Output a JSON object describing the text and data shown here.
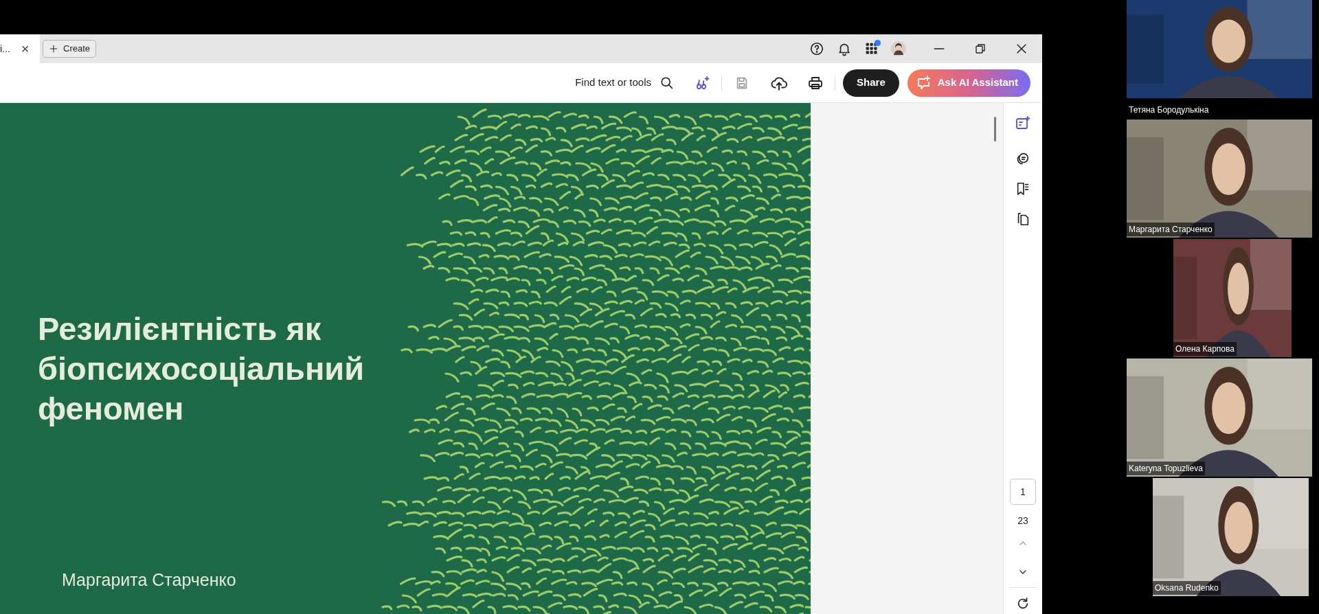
{
  "tabs": [
    {
      "title": "i...",
      "selected": true,
      "close": "×"
    }
  ],
  "create_button": "Create",
  "toolbar": {
    "search_label": "Find text or tools",
    "share_button": "Share",
    "ai_button": "Ask AI Assistant"
  },
  "apps_notification": true,
  "slide": {
    "title_lines": [
      "Резилієнтність як",
      "біопсихосоціальний",
      "феномен"
    ],
    "author": "Маргарита Старченко"
  },
  "page_nav": {
    "current": "1",
    "total": "23"
  },
  "participants": [
    {
      "name": "Тетяна Бородулькіна"
    },
    {
      "name": "Маргарита Старченко"
    },
    {
      "name": "Олена Карпова"
    },
    {
      "name": "Kateryna Topuzlieva"
    },
    {
      "name": "Oksana Rudenko"
    }
  ]
}
